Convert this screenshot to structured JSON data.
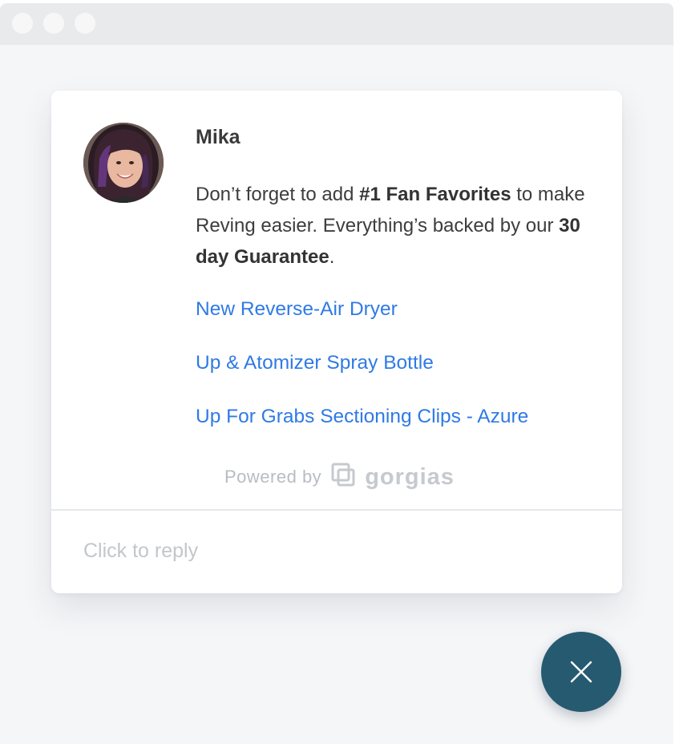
{
  "window": {
    "controls": [
      "window-dot",
      "window-dot",
      "window-dot"
    ]
  },
  "chat": {
    "sender_name": "Mika",
    "message": {
      "part1": "Don’t forget to add ",
      "bold1": "#1 Fan Favorites",
      "part2": " to make Reving easier. Everything’s backed by our ",
      "bold2": "30 day Guarantee",
      "part3": "."
    },
    "links": [
      "New Reverse-Air Dryer",
      "Up & Atomizer Spray Bottle",
      "Up For Grabs Sectioning Clips - Azure"
    ],
    "powered_by_label": "Powered by",
    "brand_word": "gorgias",
    "reply_placeholder": "Click to reply"
  },
  "icons": {
    "brand_logo": "gorgias-logo-icon",
    "close": "close-icon"
  },
  "colors": {
    "link": "#2f7ae5",
    "close_button": "#265a70",
    "text": "#3d3d3d",
    "muted": "#c3c6cb"
  }
}
